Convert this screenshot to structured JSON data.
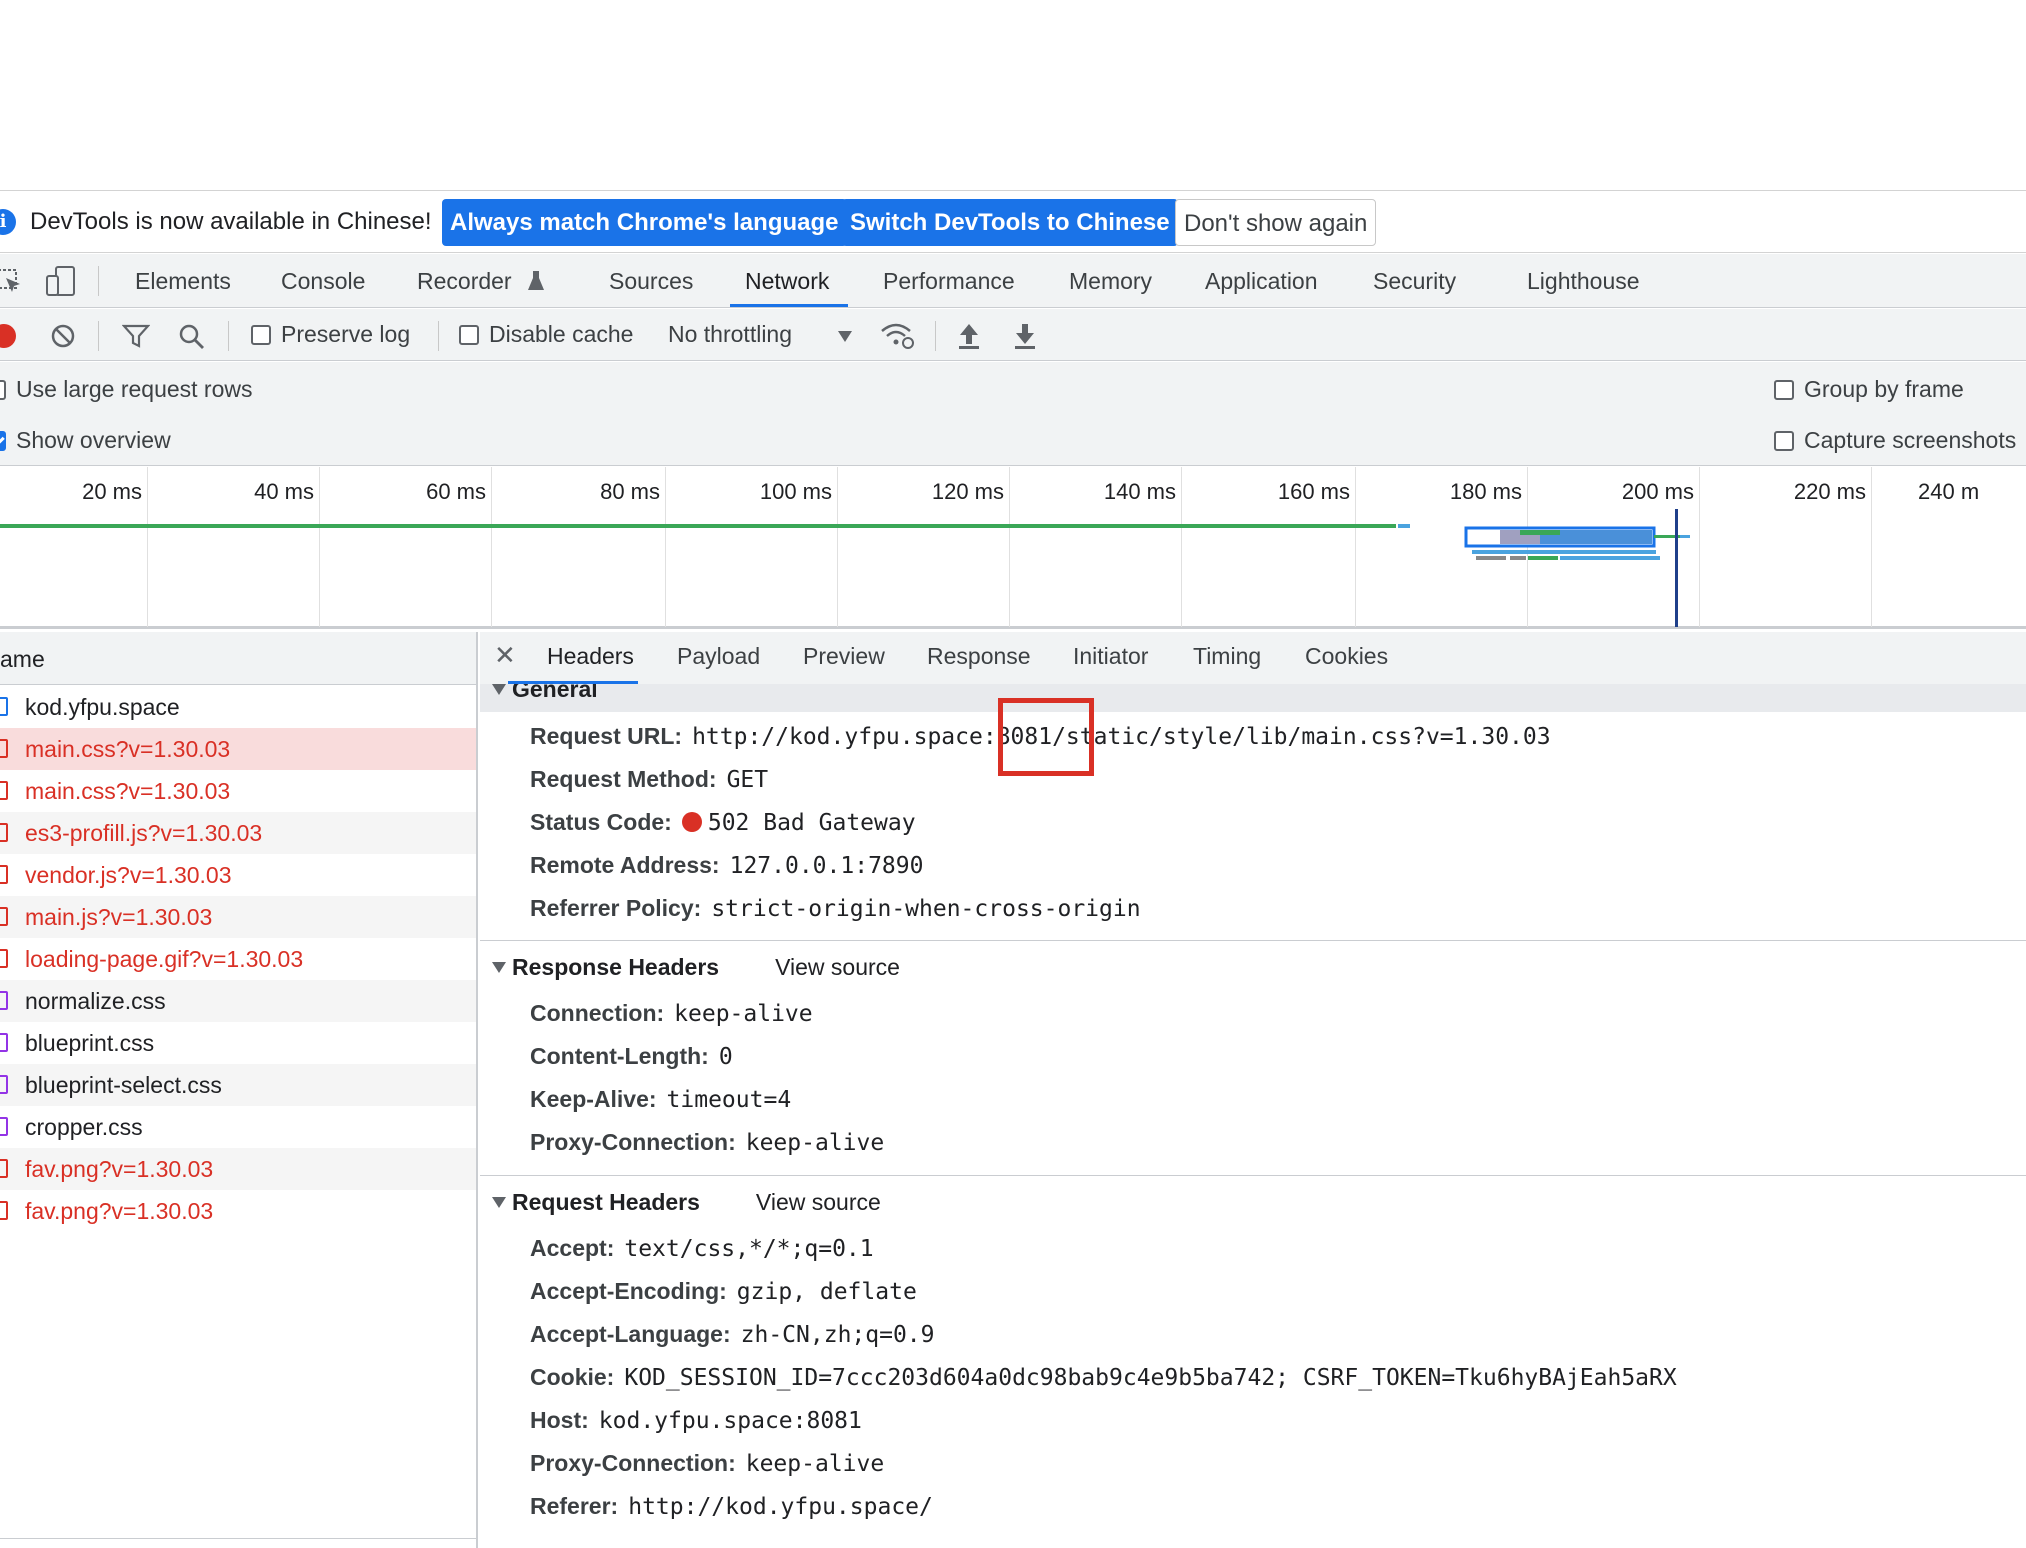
{
  "infobar": {
    "message": "DevTools is now available in Chinese!",
    "btn_match": "Always match Chrome's language",
    "btn_switch": "Switch DevTools to Chinese",
    "btn_dismiss": "Don't show again"
  },
  "tabs": {
    "elements": "Elements",
    "console": "Console",
    "recorder": "Recorder",
    "sources": "Sources",
    "network": "Network",
    "performance": "Performance",
    "memory": "Memory",
    "application": "Application",
    "security": "Security",
    "lighthouse": "Lighthouse"
  },
  "toolbar": {
    "preserve_log": "Preserve log",
    "disable_cache": "Disable cache",
    "throttling": "No throttling"
  },
  "settings": {
    "large_rows": "Use large request rows",
    "show_overview": "Show overview",
    "group_by_frame": "Group by frame",
    "capture_screenshots": "Capture screenshots"
  },
  "overview": {
    "ticks": [
      "20 ms",
      "40 ms",
      "60 ms",
      "80 ms",
      "100 ms",
      "120 ms",
      "140 ms",
      "160 ms",
      "180 ms",
      "200 ms",
      "220 ms",
      "240 m"
    ]
  },
  "request_list": {
    "column_name": "ame",
    "rows": [
      {
        "name": "kod.yfpu.space",
        "error": false
      },
      {
        "name": "main.css?v=1.30.03",
        "error": true
      },
      {
        "name": "main.css?v=1.30.03",
        "error": true
      },
      {
        "name": "es3-profill.js?v=1.30.03",
        "error": true
      },
      {
        "name": "vendor.js?v=1.30.03",
        "error": true
      },
      {
        "name": "main.js?v=1.30.03",
        "error": true
      },
      {
        "name": "loading-page.gif?v=1.30.03",
        "error": true
      },
      {
        "name": "normalize.css",
        "error": false
      },
      {
        "name": "blueprint.css",
        "error": false
      },
      {
        "name": "blueprint-select.css",
        "error": false
      },
      {
        "name": "cropper.css",
        "error": false
      },
      {
        "name": "fav.png?v=1.30.03",
        "error": true
      },
      {
        "name": "fav.png?v=1.30.03",
        "error": true
      }
    ]
  },
  "details": {
    "tabs": {
      "headers": "Headers",
      "payload": "Payload",
      "preview": "Preview",
      "response": "Response",
      "initiator": "Initiator",
      "timing": "Timing",
      "cookies": "Cookies"
    },
    "general": {
      "title": "General",
      "request_url_key": "Request URL:",
      "request_url": "http://kod.yfpu.space:8081/static/style/lib/main.css?v=1.30.03",
      "request_method_key": "Request Method:",
      "request_method": "GET",
      "status_code_key": "Status Code:",
      "status_code": "502 Bad Gateway",
      "remote_address_key": "Remote Address:",
      "remote_address": "127.0.0.1:7890",
      "referrer_policy_key": "Referrer Policy:",
      "referrer_policy": "strict-origin-when-cross-origin"
    },
    "response_headers": {
      "title": "Response Headers",
      "view_source": "View source",
      "connection_key": "Connection:",
      "connection": "keep-alive",
      "content_length_key": "Content-Length:",
      "content_length": "0",
      "keep_alive_key": "Keep-Alive:",
      "keep_alive": "timeout=4",
      "proxy_connection_key": "Proxy-Connection:",
      "proxy_connection": "keep-alive"
    },
    "request_headers": {
      "title": "Request Headers",
      "view_source": "View source",
      "accept_key": "Accept:",
      "accept": "text/css,*/*;q=0.1",
      "accept_encoding_key": "Accept-Encoding:",
      "accept_encoding": "gzip, deflate",
      "accept_language_key": "Accept-Language:",
      "accept_language": "zh-CN,zh;q=0.9",
      "cookie_key": "Cookie:",
      "cookie": "KOD_SESSION_ID=7ccc203d604a0dc98bab9c4e9b5ba742; CSRF_TOKEN=Tku6hyBAjEah5aRX",
      "host_key": "Host:",
      "host": "kod.yfpu.space:8081",
      "proxy_connection_key": "Proxy-Connection:",
      "proxy_connection": "keep-alive",
      "referer_key": "Referer:",
      "referer": "http://kod.yfpu.space/"
    }
  }
}
